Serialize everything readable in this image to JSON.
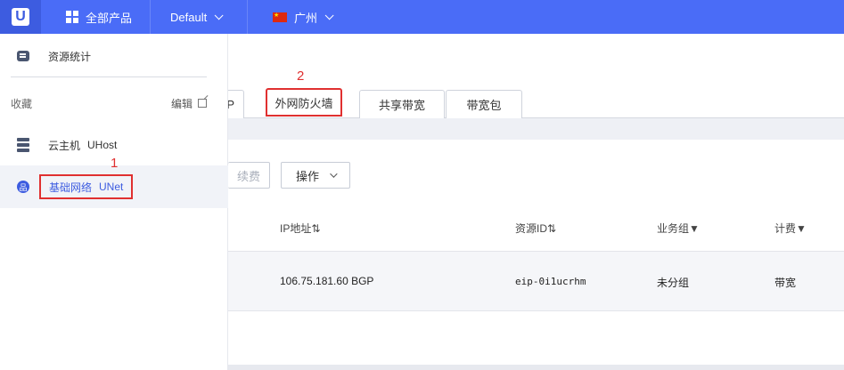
{
  "header": {
    "logo": "U",
    "products_label": "全部产品",
    "project_label": "Default",
    "region_label": "广州"
  },
  "sidebar": {
    "stats_label": "资源统计",
    "favorites_label": "收藏",
    "edit_label": "编辑",
    "items": [
      {
        "name": "云主机",
        "product": "UHost"
      },
      {
        "name": "基础网络",
        "product": "UNet"
      }
    ]
  },
  "tabs": {
    "partial_label": "P",
    "firewall_label": "外网防火墙",
    "shared_bw_label": "共享带宽",
    "bw_package_label": "带宽包"
  },
  "toolbar": {
    "renew_label": "续费",
    "operate_label": "操作"
  },
  "table": {
    "columns": [
      "IP地址⇅",
      "资源ID⇅",
      "业务组▼",
      "计费▼"
    ],
    "rows": [
      {
        "ip": "106.75.181.60 BGP",
        "resource_id": "eip-0i1ucrhm",
        "group": "未分组",
        "billing": "带宽"
      }
    ]
  },
  "annotations": {
    "one": "1",
    "two": "2"
  },
  "colors": {
    "topbar": "#4a6cf7",
    "highlight": "#e03030",
    "link": "#3d5ce0"
  }
}
